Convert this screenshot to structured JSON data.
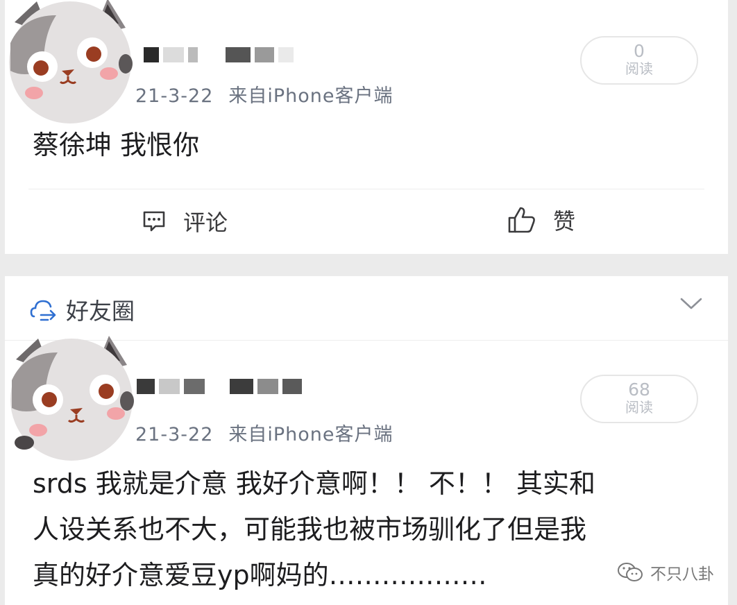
{
  "posts": [
    {
      "date": "21-3-22",
      "source": "来自iPhone客户端",
      "read_count": "0",
      "read_label": "阅读",
      "lines": [
        "蔡徐坤 我恨你"
      ]
    },
    {
      "date": "21-3-22",
      "source": "来自iPhone客户端",
      "read_count": "68",
      "read_label": "阅读",
      "lines": [
        "srds 我就是介意 我好介意啊！！ 不！！ 其实和",
        "人设关系也不大，可能我也被市场驯化了但是我",
        "真的好介意爱豆yp啊妈的………………"
      ]
    }
  ],
  "actions": {
    "comment_label": "评论",
    "like_label": "赞"
  },
  "section": {
    "title": "好友圈"
  },
  "watermark": {
    "text": "不只八卦"
  },
  "icons": [
    "comment-icon",
    "thumbs-up-icon",
    "friends-circle-icon",
    "chevron-down-icon",
    "wechat-icon"
  ]
}
